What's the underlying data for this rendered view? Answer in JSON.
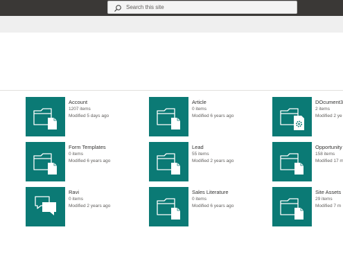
{
  "search": {
    "placeholder": "Search this site"
  },
  "colors": {
    "tile": "#0b7a75",
    "topbar": "#3a3836"
  },
  "libraries": [
    {
      "name": "Account",
      "count": "1207 items",
      "modified": "Modified 5 days ago",
      "icon": "folder-icon"
    },
    {
      "name": "Article",
      "count": "0 items",
      "modified": "Modified 6 years ago",
      "icon": "folder-icon"
    },
    {
      "name": "DOcument3",
      "count": "2 items",
      "modified": "Modified 2 ye",
      "icon": "folder-settings-icon"
    },
    {
      "name": "Form Templates",
      "count": "0 items",
      "modified": "Modified 6 years ago",
      "icon": "folder-icon"
    },
    {
      "name": "Lead",
      "count": "55 items",
      "modified": "Modified 2 years ago",
      "icon": "folder-icon"
    },
    {
      "name": "Opportunity",
      "count": "158 items",
      "modified": "Modified 17 m",
      "icon": "folder-icon"
    },
    {
      "name": "Ravi",
      "count": "0 items",
      "modified": "Modified 2 years ago",
      "icon": "chat-bubbles-icon"
    },
    {
      "name": "Sales Literature",
      "count": "0 items",
      "modified": "Modified 6 years ago",
      "icon": "folder-icon"
    },
    {
      "name": "Site Assets",
      "count": "29 items",
      "modified": "Modified 7 m",
      "icon": "folder-icon"
    }
  ]
}
